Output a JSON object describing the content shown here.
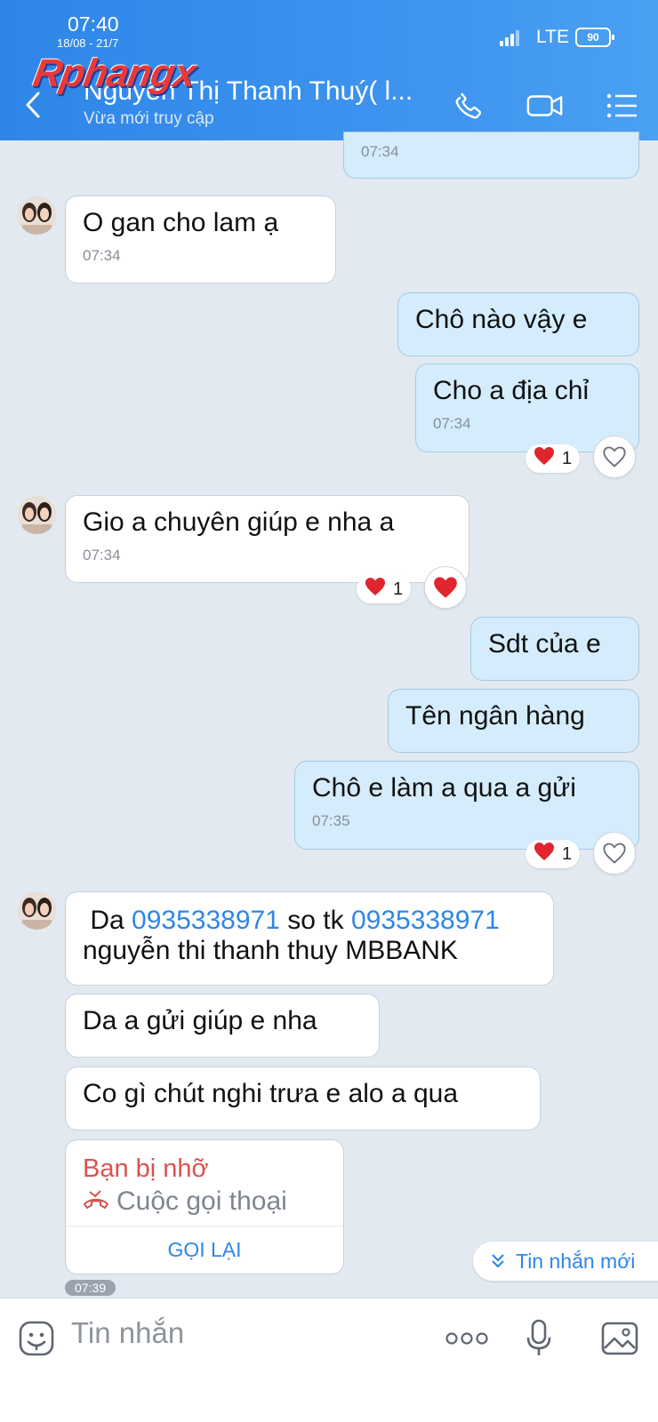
{
  "status_bar": {
    "time": "07:40",
    "date": "18/08 - 21/7",
    "network": "LTE",
    "battery": "90"
  },
  "watermark": "Rphangx",
  "header": {
    "title": "Nguyễn Thị Thanh Thuý( l...",
    "subtitle": "Vừa mới truy cập"
  },
  "messages": {
    "m0": {
      "time": "07:34"
    },
    "m1": {
      "text": "O gan cho lam ạ",
      "time": "07:34"
    },
    "m2": {
      "text": "Chô nào vậy e"
    },
    "m3": {
      "text": "Cho a địa chỉ",
      "time": "07:34",
      "reaction_count": "1"
    },
    "m4": {
      "text": "Gio a chuyên giúp e nha a",
      "time": "07:34",
      "reaction_count": "1"
    },
    "m5": {
      "text": "Sdt của e"
    },
    "m6": {
      "text": "Tên ngân hàng"
    },
    "m7": {
      "text": "Chô e làm a qua a gửi",
      "time": "07:35",
      "reaction_count": "1"
    },
    "m8": {
      "prefix": "Da",
      "phone": "0935338971",
      "middle": "so tk",
      "account": "0935338971",
      "line2": "nguyễn thi thanh thuy MBBANK"
    },
    "m9": {
      "text": "Da a gửi giúp e nha"
    },
    "m10": {
      "text": "Co gì chút nghi trưa e alo a qua"
    }
  },
  "missed_call": {
    "title": "Bạn bị nhỡ",
    "type": "Cuộc gọi thoại",
    "action": "GỌI LẠI",
    "time": "07:39"
  },
  "new_messages": "Tin nhắn mới",
  "input": {
    "placeholder": "Tin nhắn"
  },
  "colors": {
    "header": "#3d93ee",
    "accent": "#2f86e8",
    "outgoing_bubble": "#d4ecfb",
    "background": "#e2e9f1",
    "missed": "#d9534f",
    "heart": "#e0252f"
  }
}
